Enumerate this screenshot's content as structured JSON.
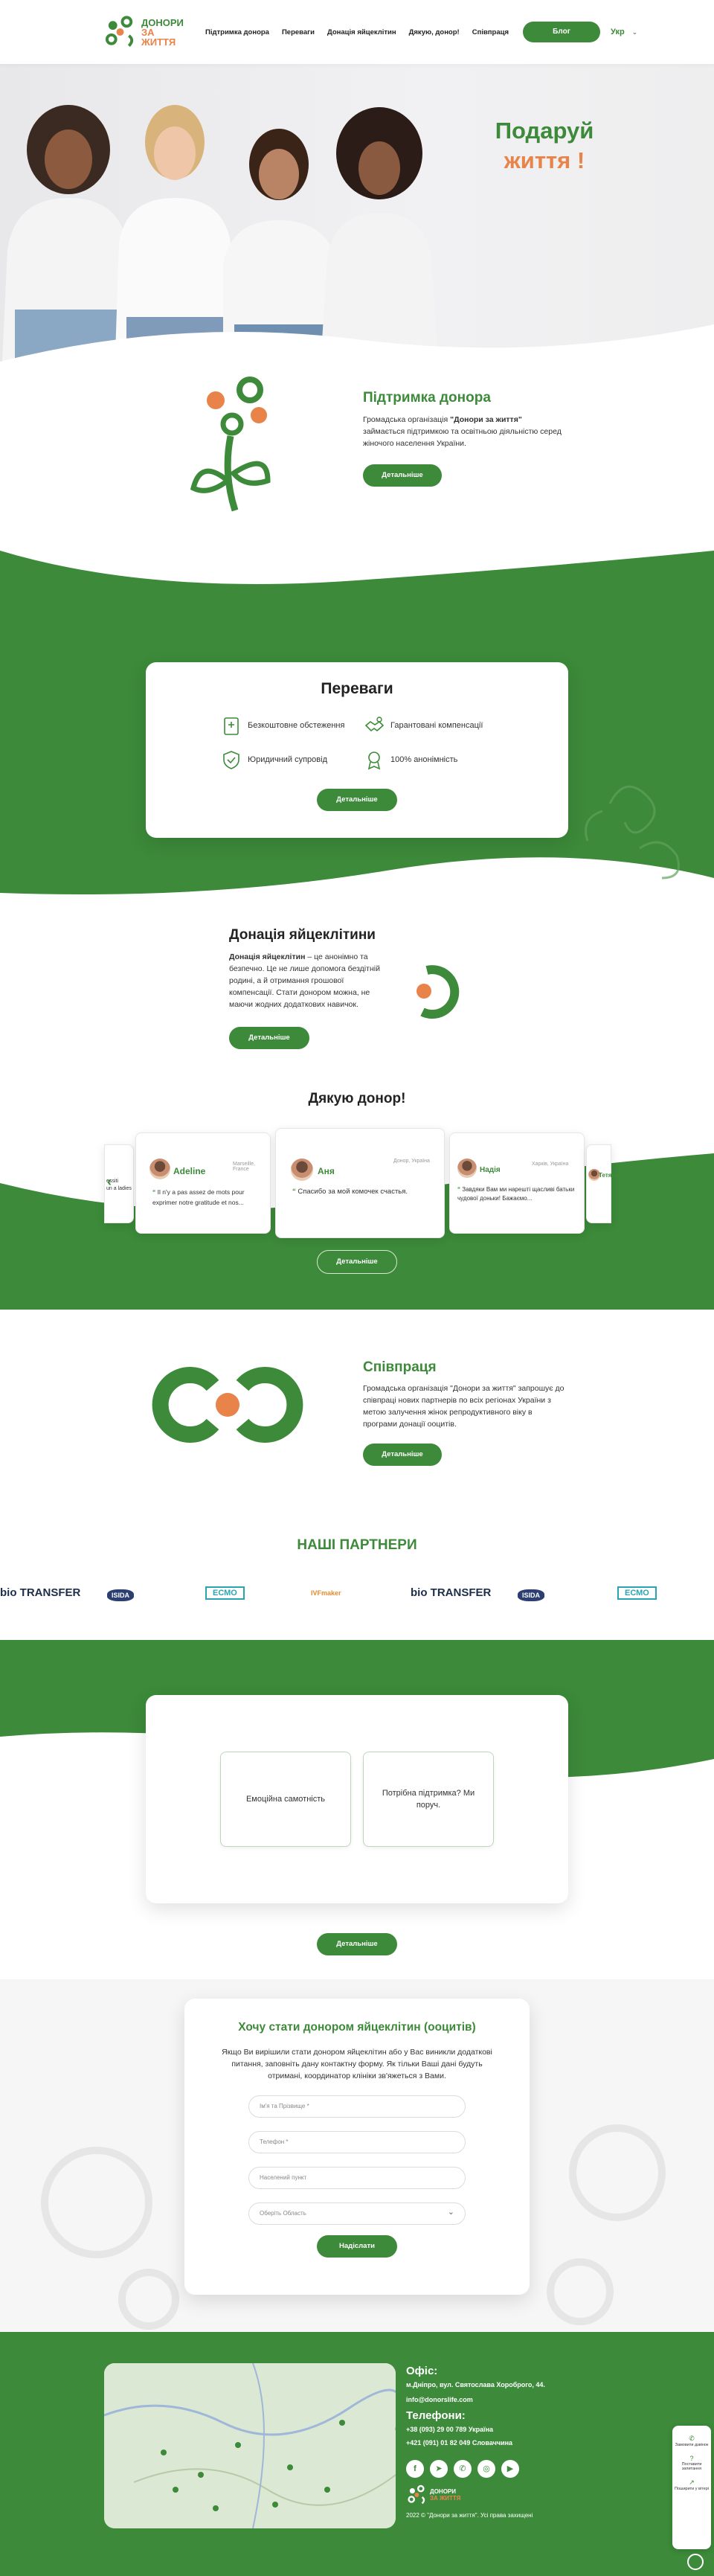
{
  "header": {
    "logo_line1": "ДОНОРИ",
    "logo_line2": "ЗА ЖИТТЯ",
    "nav": [
      "Підтримка донора",
      "Переваги",
      "Донація яйцеклітин",
      "Дякую, донор!",
      "Співпраця"
    ],
    "blog_label": "Блог",
    "lang": "Укр"
  },
  "hero": {
    "title_line1": "Подаруй",
    "title_line2": "життя !"
  },
  "support": {
    "title": "Підтримка донора",
    "text_prefix": "Громадська організація ",
    "text_bold": "\"Донори за життя\"",
    "text_suffix": " займається підтримкою та освітньою діяльністю серед жіночого населення України.",
    "button": "Детальніше"
  },
  "advantages": {
    "title": "Переваги",
    "items": [
      "Безкоштовне обстеження",
      "Гарантовані компенсації",
      "Юридичний супровід",
      "100% анонімність"
    ],
    "button": "Детальніше"
  },
  "donation": {
    "title": "Донація яйцеклітини",
    "text_bold": "Донація яйцеклітин",
    "text_rest": " – це анонімно та безпечно. Це не лише допомога бездітній родині, а й отримання грошової компенсації. Стати донором можна, не маючи жодних додаткових навичок.",
    "button": "Детальніше"
  },
  "thanks": {
    "title": "Дякую донор!",
    "reviews": [
      {
        "name": "Adeline",
        "label": "Marseille, France",
        "text": "Il n'y a pas assez de mots pour exprimer notre gratitude et nos..."
      },
      {
        "name": "Аня",
        "label": "Донор, Україна",
        "text": "Спасибо за мой комочек счастья."
      },
      {
        "name": "Надія",
        "label": "Харків, Україна",
        "text": "Завдяки Вам ми нарешті щасливі батьки чудової доньки! Бажаємо..."
      }
    ],
    "left_partial_text": "essiti\nun a ladies",
    "right_partial_name": "Тетяна",
    "button": "Детальніше"
  },
  "cooperation": {
    "title": "Співпраця",
    "text": "Громадська організація \"Донори за життя\" запрошує до співпраці нових партнерів по всіх регіонах України з метою залучення жінок репродуктивного віку в програми донації ооцитів.",
    "button": "Детальніше"
  },
  "partners": {
    "title": "НАШІ ПАРТНЕРИ",
    "logos": [
      "bio TRANSFER",
      "ISIDA",
      "ЕСМО",
      "IVFmaker",
      "bio TRANSFER",
      "ISIDA",
      "ЕСМО"
    ]
  },
  "emotions": {
    "boxes": [
      "Емоційна самотність",
      "Потрібна підтримка? Ми поруч."
    ],
    "button": "Детальніше"
  },
  "form": {
    "title": "Хочу стати донором яйцеклітин (ооцитів)",
    "text": "Якщо Ви вирішили стати донором яйцеклітин або у Вас виникли додаткові питання, заповніть дану контактну форму. Як тільки Ваші дані будуть отримані, координатор клініки зв'яжеться з Вами.",
    "fields": [
      "Ім'я та Прізвище *",
      "Телефон *",
      "Населений пункт",
      "Оберіть Область"
    ],
    "submit": "Надіслати"
  },
  "footer": {
    "office_title": "Офіс:",
    "address": "м.Дніпро, вул. Святослава Хороброго, 44.",
    "email": "info@donorslife.com",
    "phones_title": "Телефони:",
    "phone1": "+38 (093) 29 00 789 Україна",
    "phone2": "+421 (091) 01 82 049 Словаччина",
    "copyright": "2022 © \"Донори за життя\". Усі права захищені",
    "logo_line1": "ДОНОРИ",
    "logo_line2": "ЗА ЖИТТЯ"
  },
  "widget": {
    "items": [
      "Замовити дзвінок",
      "Поставити запитання",
      "Поширити у вітері"
    ]
  },
  "colors": {
    "brand_green": "#3c8a3a",
    "accent_orange": "#e8834a"
  }
}
